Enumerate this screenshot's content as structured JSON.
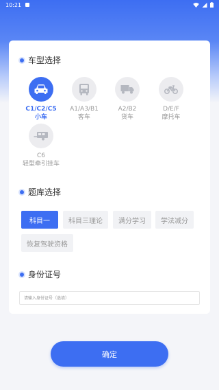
{
  "status_bar": {
    "time": "10:21"
  },
  "sections": {
    "vehicle_type": "车型选择",
    "question_bank": "题库选择",
    "id_number": "身份证号"
  },
  "vehicles": [
    {
      "code": "C1/C2/C5",
      "name": "小车",
      "icon": "car-icon",
      "active": true
    },
    {
      "code": "A1/A3/B1",
      "name": "客车",
      "icon": "bus-icon",
      "active": false
    },
    {
      "code": "A2/B2",
      "name": "货车",
      "icon": "truck-icon",
      "active": false
    },
    {
      "code": "D/E/F",
      "name": "摩托车",
      "icon": "motorcycle-icon",
      "active": false
    },
    {
      "code": "C6",
      "name": "轻型牵引挂车",
      "icon": "trailer-icon",
      "active": false
    }
  ],
  "question_banks": [
    {
      "label": "科目一",
      "active": true
    },
    {
      "label": "科目三理论",
      "active": false
    },
    {
      "label": "满分学习",
      "active": false
    },
    {
      "label": "学法减分",
      "active": false
    },
    {
      "label": "恢复驾驶资格",
      "active": false
    }
  ],
  "id_field": {
    "placeholder": "请输入身份证号（选填）",
    "value": ""
  },
  "confirm_label": "确定",
  "colors": {
    "accent": "#3d6ef2",
    "inactive_icon_bg": "#ececef"
  }
}
